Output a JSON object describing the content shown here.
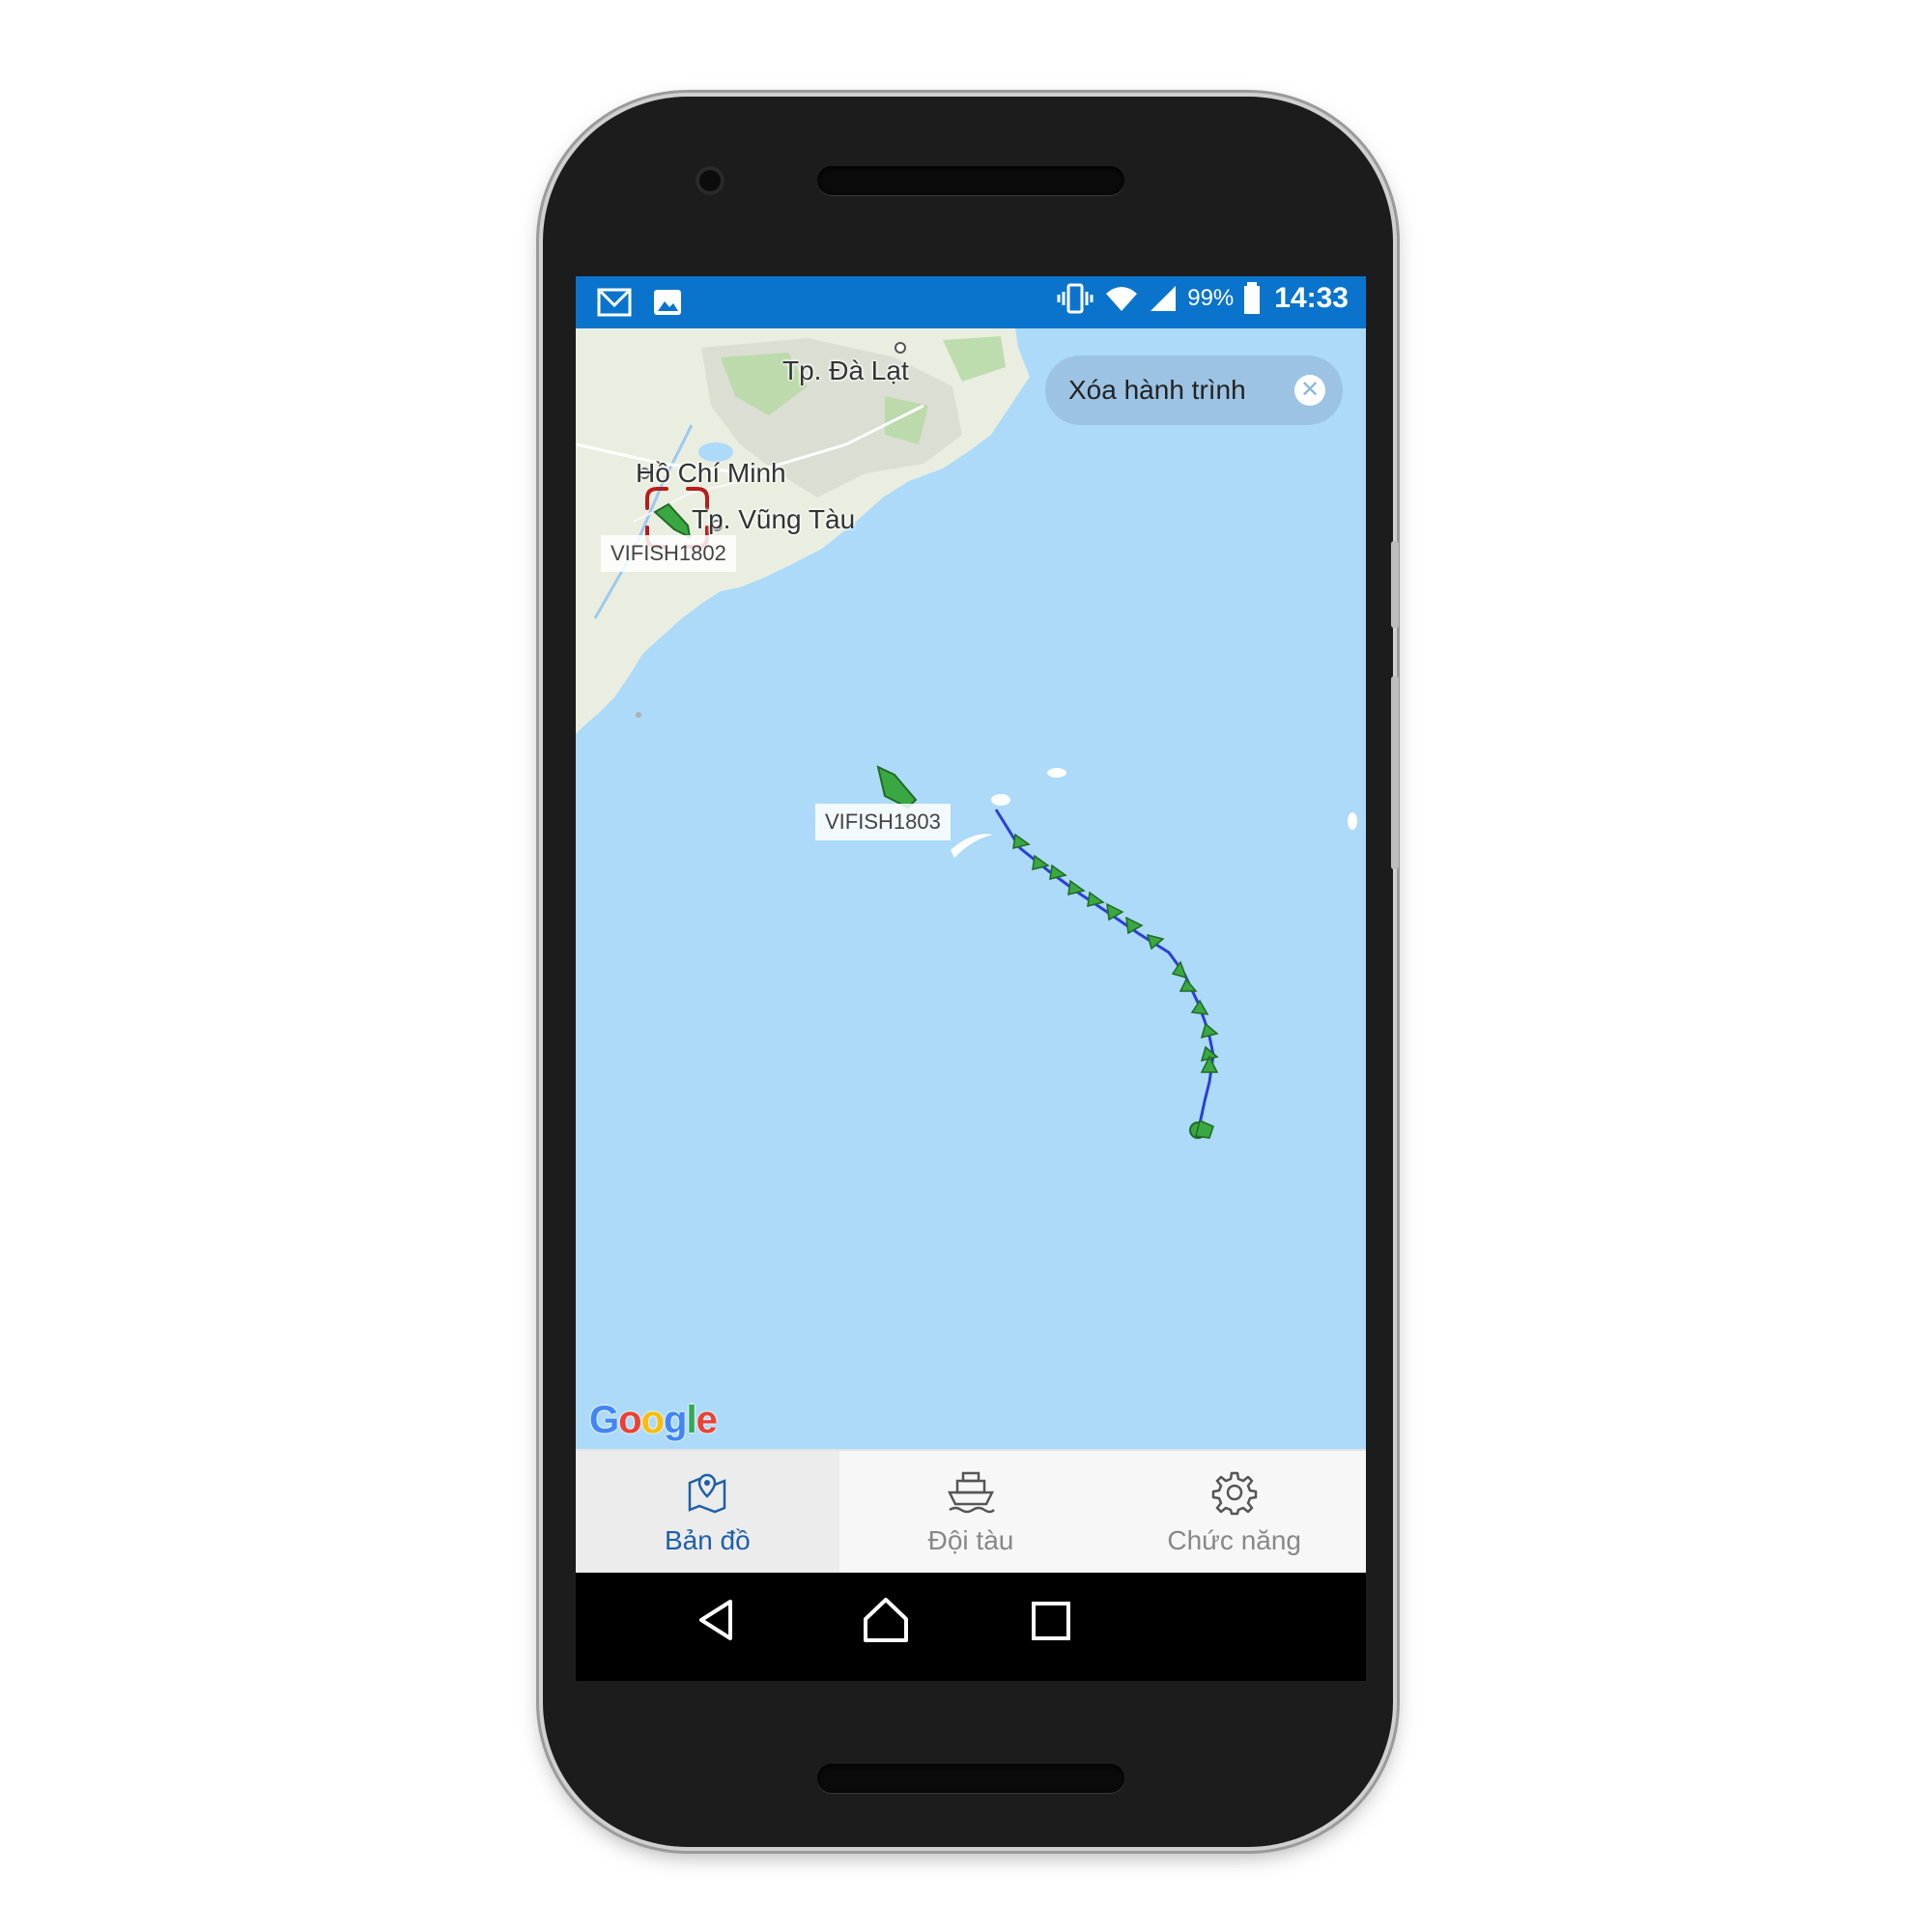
{
  "status_bar": {
    "notification_icons": [
      "mail-icon",
      "image-icon"
    ],
    "system_icons": [
      "vibrate-icon",
      "wifi-icon",
      "signal-icon",
      "battery-icon"
    ],
    "battery": "99%",
    "time": "14:33"
  },
  "map": {
    "cities": {
      "da_lat": "Tp. Đà Lạt",
      "hcm": "Hồ Chí Minh",
      "vung_tau": "Tp. Vũng Tàu"
    },
    "vessels": {
      "vessel_1": "VIFISH1802",
      "vessel_2": "VIFISH1803"
    },
    "clear_track_button": "Xóa hành trình",
    "attribution": [
      "G",
      "o",
      "o",
      "g",
      "l",
      "e"
    ],
    "colors": {
      "sea": "#acdaf8",
      "vessel": "#3aa842",
      "track_line": "#2b3fd6",
      "selection": "#b71c1c"
    }
  },
  "tabs": [
    {
      "label": "Bản đồ",
      "icon": "map-pin-icon",
      "active": true
    },
    {
      "label": "Đội tàu",
      "icon": "ship-icon",
      "active": false
    },
    {
      "label": "Chức năng",
      "icon": "gear-icon",
      "active": false
    }
  ],
  "nav": [
    "back-icon",
    "home-icon",
    "recents-icon"
  ],
  "accent_color": "#0a74cc"
}
